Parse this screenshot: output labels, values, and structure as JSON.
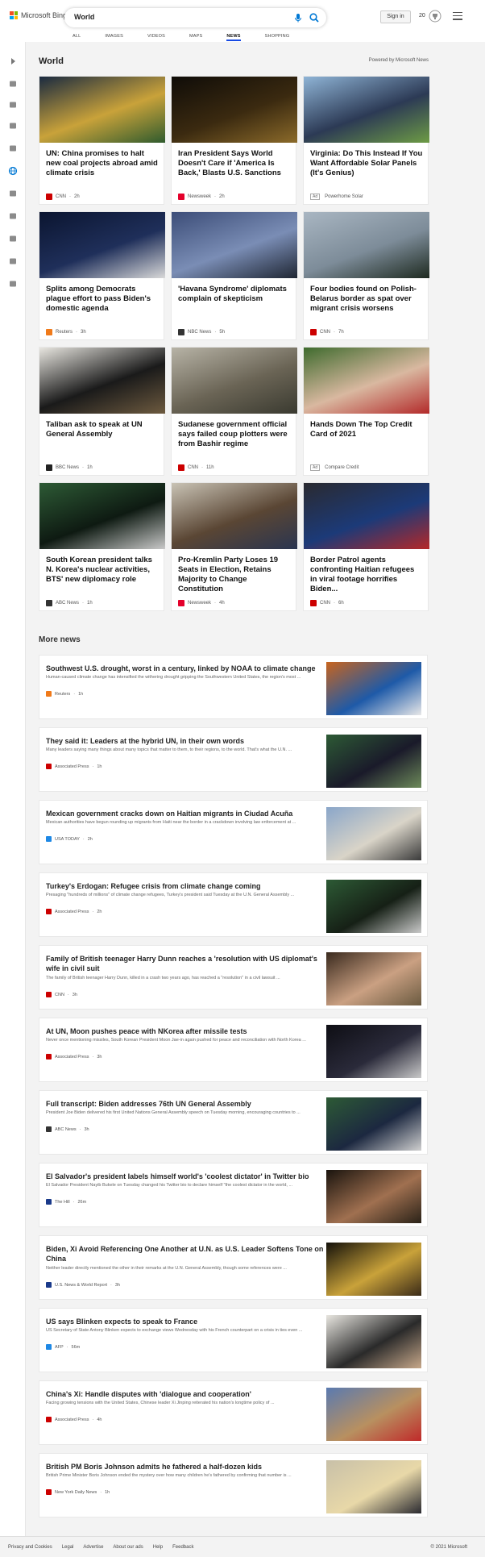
{
  "header": {
    "brand": "Microsoft Bing",
    "query": "World",
    "signin": "Sign in",
    "points": "20",
    "tabs": [
      "ALL",
      "IMAGES",
      "VIDEOS",
      "MAPS",
      "NEWS",
      "SHOPPING"
    ],
    "active_tab": "NEWS"
  },
  "sidebar_icons": [
    "expand-arrow-icon",
    "home-icon",
    "trending-icon",
    "flag-icon",
    "location-pin-icon",
    "globe-icon",
    "scale-icon",
    "rocket-icon",
    "entertainment-icon",
    "building-icon",
    "card-icon"
  ],
  "section": {
    "title": "World",
    "powered": "Powered by Microsoft News"
  },
  "cards": [
    {
      "title": "UN: China promises to halt new coal projects abroad amid climate crisis",
      "source": "CNN",
      "age": "2h",
      "src_color": "#cc0000",
      "img": [
        "#1a2a40",
        "#c9a23a",
        "#2f5b2e"
      ]
    },
    {
      "title": "Iran President Says World Doesn't Care if 'America Is Back,' Blasts U.S. Sanctions",
      "source": "Newsweek",
      "age": "2h",
      "src_color": "#e4002b",
      "img": [
        "#0f0c08",
        "#3b2a10",
        "#8b6a2a"
      ]
    },
    {
      "title": "Virginia: Do This Instead If You Want Affordable Solar Panels (It's Genius)",
      "source": "Powerhome Solar",
      "age": "",
      "ad": "Ad",
      "src_color": "",
      "img": [
        "#8fb4d6",
        "#2c3a55",
        "#6d9b45"
      ]
    },
    {
      "title": "Splits among Democrats plague effort to pass Biden's domestic agenda",
      "source": "Reuters",
      "age": "3h",
      "src_color": "#f07a1a",
      "img": [
        "#0b1530",
        "#1f2f5a",
        "#d9d9d9"
      ]
    },
    {
      "title": "'Havana Syndrome' diplomats complain of skepticism",
      "source": "NBC News",
      "age": "5h",
      "src_color": "#333333",
      "img": [
        "#3c4d78",
        "#7a8db5",
        "#1f2633"
      ]
    },
    {
      "title": "Four bodies found on Polish-Belarus border as spat over migrant crisis worsens",
      "source": "CNN",
      "age": "7h",
      "src_color": "#cc0000",
      "img": [
        "#a9b6c2",
        "#7d8c99",
        "#1e2a20"
      ]
    },
    {
      "title": "Taliban ask to speak at UN General Assembly",
      "source": "BBC News",
      "age": "1h",
      "src_color": "#222222",
      "img": [
        "#e8e6e0",
        "#1a1a1a",
        "#6d5a3f"
      ]
    },
    {
      "title": "Sudanese government official says failed coup plotters were from Bashir regime",
      "source": "CNN",
      "age": "11h",
      "src_color": "#cc0000",
      "img": [
        "#b7b3a6",
        "#6a6455",
        "#3a3a30"
      ]
    },
    {
      "title": "Hands Down The Top Credit Card of 2021",
      "source": "Compare Credit",
      "age": "",
      "ad": "Ad",
      "src_color": "",
      "img": [
        "#3f6b2e",
        "#d9b8a0",
        "#b32a2a"
      ]
    },
    {
      "title": "South Korean president talks N. Korea's nuclear activities, BTS' new diplomacy role",
      "source": "ABC News",
      "age": "1h",
      "src_color": "#333333",
      "img": [
        "#2d5a35",
        "#0e1a12",
        "#c9c9c9"
      ]
    },
    {
      "title": "Pro-Kremlin Party Loses 19 Seats in Election, Retains Majority to Change Constitution",
      "source": "Newsweek",
      "age": "4h",
      "src_color": "#e4002b",
      "img": [
        "#c9c3b5",
        "#5a4634",
        "#2a3550"
      ]
    },
    {
      "title": "Border Patrol agents confronting Haitian refugees in viral footage horrifies Biden...",
      "source": "CNN",
      "age": "6h",
      "src_color": "#cc0000",
      "img": [
        "#2a2a30",
        "#1c3a78",
        "#b52828"
      ]
    }
  ],
  "more_news": {
    "title": "More news",
    "items": [
      {
        "title": "Southwest U.S. drought, worst in a century, linked by NOAA to climate change",
        "desc": "Human-caused climate change has intensified the withering drought gripping the Southwestern United States, the region's most ...",
        "source": "Reuters",
        "age": "1h",
        "src_color": "#f07a1a",
        "img": [
          "#c8641e",
          "#1e5aa8",
          "#e8e8e8"
        ]
      },
      {
        "title": "They said it: Leaders at the hybrid UN, in their own words",
        "desc": "Many leaders saying many things about many topics that matter to them, to their regions, to the world. That's what the U.N. ...",
        "source": "Associated Press",
        "age": "1h",
        "src_color": "#cc0000",
        "img": [
          "#2d5a35",
          "#1a1a2a",
          "#6d8a5a"
        ]
      },
      {
        "title": "Mexican government cracks down on Haitian migrants in Ciudad Acuña",
        "desc": "Mexican authorities have begun rounding up migrants from Haiti near the border in a crackdown involving law enforcement at ...",
        "source": "USA TODAY",
        "age": "2h",
        "src_color": "#1e88e5",
        "img": [
          "#8aa6c9",
          "#d9d4c8",
          "#3a3a3a"
        ]
      },
      {
        "title": "Turkey's Erdogan: Refugee crisis from climate change coming",
        "desc": "Presaging \"hundreds of millions\" of climate change refugees, Turkey's president said Tuesday at the U.N. General Assembly ...",
        "source": "Associated Press",
        "age": "2h",
        "src_color": "#cc0000",
        "img": [
          "#2d5a35",
          "#162016",
          "#c9c9c9"
        ]
      },
      {
        "title": "Family of British teenager Harry Dunn reaches a 'resolution with US diplomat's wife in civil suit",
        "desc": "The family of British teenager Harry Dunn, killed in a crash two years ago, has reached a \"resolution\" in a civil lawsuit ...",
        "source": "CNN",
        "age": "3h",
        "src_color": "#cc0000",
        "img": [
          "#3a2a1e",
          "#caa082",
          "#6a5a40"
        ]
      },
      {
        "title": "At UN, Moon pushes peace with NKorea after missile tests",
        "desc": "Never once mentioning missiles, South Korean President Moon Jae-in again pushed for peace and reconciliation with North Korea ...",
        "source": "Associated Press",
        "age": "3h",
        "src_color": "#cc0000",
        "img": [
          "#0e0e14",
          "#2a2a3a",
          "#c9c9c9"
        ]
      },
      {
        "title": "Full transcript: Biden addresses 76th UN General Assembly",
        "desc": "President Joe Biden delivered his first United Nations General Assembly speech on Tuesday morning, encouraging countries to ...",
        "source": "ABC News",
        "age": "3h",
        "src_color": "#333333",
        "img": [
          "#2d5a35",
          "#1c2840",
          "#d0d0d0"
        ]
      },
      {
        "title": "El Salvador's president labels himself world's 'coolest dictator' in Twitter bio",
        "desc": "El Salvador President Nayib Bukele on Tuesday changed his Twitter bio to declare himself \"the coolest dictator in the world, ...",
        "source": "The Hill",
        "age": "26m",
        "src_color": "#1a3a8a",
        "img": [
          "#1a140e",
          "#a07050",
          "#2a2218"
        ]
      },
      {
        "title": "Biden, Xi Avoid Referencing One Another at U.N. as U.S. Leader Softens Tone on China",
        "desc": "Neither leader directly mentioned the other in their remarks at the U.N. General Assembly, though some references were ...",
        "source": "U.S. News & World Report",
        "age": "3h",
        "src_color": "#1a3a8a",
        "img": [
          "#14110a",
          "#c9a23a",
          "#3a2a18"
        ]
      },
      {
        "title": "US says Blinken expects to speak to France",
        "desc": "US Secretary of State Antony Blinken expects to exchange views Wednesday with his French counterpart on a crisis in ties even ...",
        "source": "AFP",
        "age": "56m",
        "src_color": "#1e88e5",
        "img": [
          "#e8e6e0",
          "#2a2a2a",
          "#c7a88a"
        ]
      },
      {
        "title": "China's Xi: Handle disputes with 'dialogue and cooperation'",
        "desc": "Facing growing tensions with the United States, Chinese leader Xi Jinping reiterated his nation's longtime policy of ...",
        "source": "Associated Press",
        "age": "4h",
        "src_color": "#cc0000",
        "img": [
          "#5a7ab0",
          "#b89060",
          "#c02a2a"
        ]
      },
      {
        "title": "British PM Boris Johnson admits he fathered a half-dozen kids",
        "desc": "British Prime Minister Boris Johnson ended the mystery over how many children he's fathered by confirming that number is ...",
        "source": "New York Daily News",
        "age": "1h",
        "src_color": "#cc0000",
        "img": [
          "#c8c0a8",
          "#e8d8a8",
          "#2a2a30"
        ]
      }
    ]
  },
  "footer": {
    "links": [
      "Privacy and Cookies",
      "Legal",
      "Advertise",
      "About our ads",
      "Help",
      "Feedback"
    ],
    "copyright": "© 2021 Microsoft"
  }
}
